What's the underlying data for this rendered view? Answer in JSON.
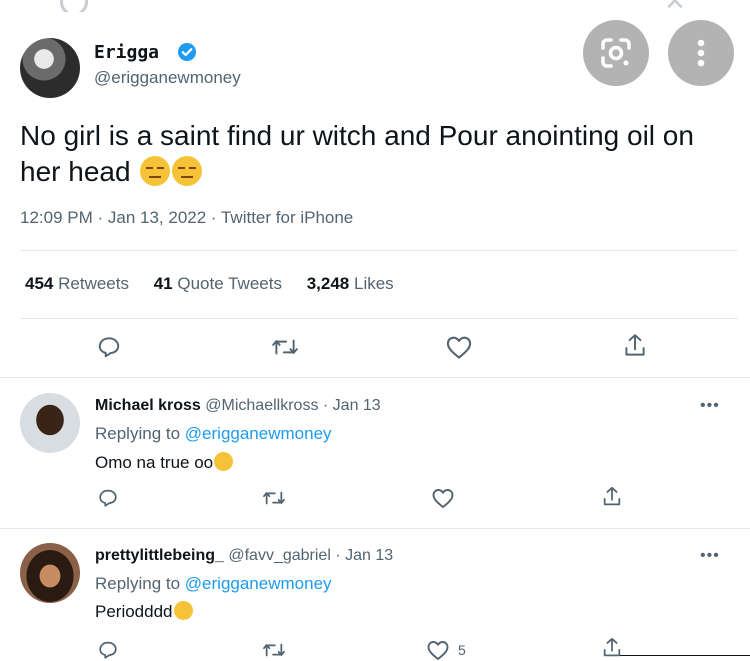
{
  "colors": {
    "accent": "#1d9bf0",
    "muted": "#536471",
    "text": "#0f1419",
    "emoji": "#f6c338"
  },
  "overlay": {
    "lens_icon": "google-lens-icon",
    "more_icon": "more-vertical-icon"
  },
  "tweet": {
    "author_name": "Erigga",
    "author_handle": "@erigganewmoney",
    "text": "No girl is a saint find ur witch and Pour anointing oil on her head",
    "emojis": [
      "unamused-face",
      "unamused-face"
    ],
    "timestamp": "12:09 PM · Jan 13, 2022 · Twitter for iPhone",
    "stats": [
      {
        "count": "454",
        "label": "Retweets"
      },
      {
        "count": "41",
        "label": "Quote Tweets"
      },
      {
        "count": "3,248",
        "label": "Likes"
      }
    ]
  },
  "replies": [
    {
      "name": "Michael kross",
      "handle": "@Michaellkross",
      "date": "· Jan 13",
      "replying_prefix": "Replying to",
      "replying_to": "@erigganewmoney",
      "text": "Omo na true oo",
      "emoji": "nerd-face",
      "like_count": ""
    },
    {
      "name": "prettylittlebeing_",
      "handle": "@favv_gabriel",
      "date": "· Jan 13",
      "replying_prefix": "Replying to",
      "replying_to": "@erigganewmoney",
      "text": "Periodddd",
      "emoji": "laughing-crying-face",
      "like_count": "5"
    }
  ]
}
